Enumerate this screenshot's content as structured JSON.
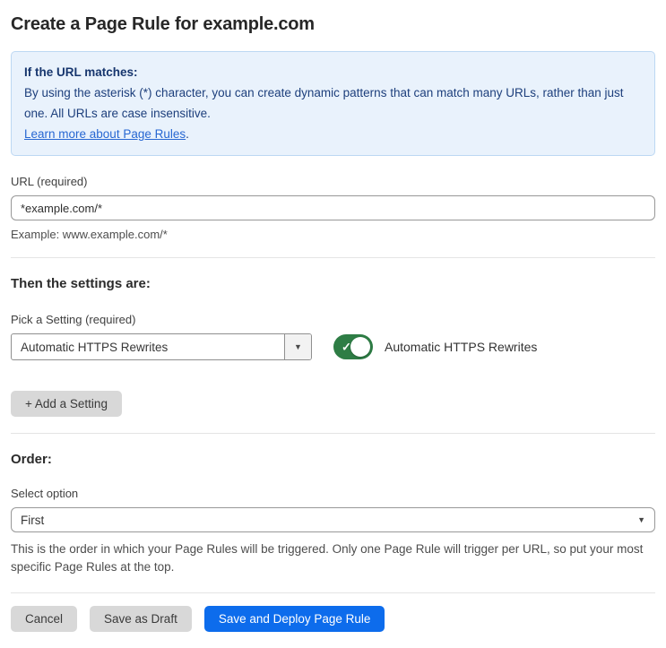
{
  "page": {
    "title": "Create a Page Rule for example.com"
  },
  "info_box": {
    "heading": "If the URL matches:",
    "body": "By using the asterisk (*) character, you can create dynamic patterns that can match many URLs, rather than just one. All URLs are case insensitive.",
    "link_text": "Learn more about Page Rules",
    "link_suffix": "."
  },
  "url_section": {
    "label": "URL (required)",
    "value": "*example.com/*",
    "example": "Example: www.example.com/*"
  },
  "settings_section": {
    "heading": "Then the settings are:",
    "picker_label": "Pick a Setting (required)",
    "picker_value": "Automatic HTTPS Rewrites",
    "toggle_label": "Automatic HTTPS Rewrites",
    "toggle_state": "on",
    "add_button_label": "+ Add a Setting"
  },
  "order_section": {
    "heading": "Order:",
    "label": "Select option",
    "value": "First",
    "help": "This is the order in which your Page Rules will be triggered. Only one Page Rule will trigger per URL, so put your most specific Page Rules at the top."
  },
  "footer": {
    "cancel_label": "Cancel",
    "save_draft_label": "Save as Draft",
    "save_deploy_label": "Save and Deploy Page Rule"
  },
  "icons": {
    "dropdown_arrow": "▼",
    "check": "✓"
  },
  "colors": {
    "accent_blue": "#0d6cec",
    "toggle_green": "#2e7d45",
    "info_bg": "#e9f2fc",
    "info_border": "#bdd8f3",
    "info_text": "#1d3f7c",
    "link_blue": "#2767d2"
  }
}
